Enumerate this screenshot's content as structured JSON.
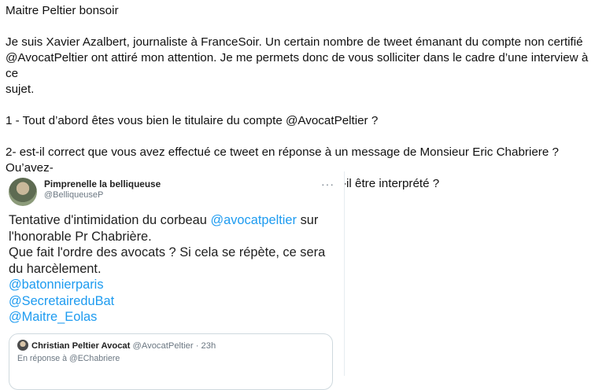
{
  "email": {
    "greeting": "Maitre Peltier bonsoir",
    "intro_line1": "Je suis Xavier Azalbert, journaliste à FranceSoir. Un certain nombre de tweet émanant du compte non certifié",
    "intro_line2": "@AvocatPeltier ont attiré mon attention. Je me permets donc de vous solliciter dans le cadre d’une interview à ce",
    "intro_line3": "sujet.",
    "question1": "1 - Tout d’abord êtes vous bien le titulaire du compte @AvocatPeltier ?",
    "question2_line1": "2- est-il correct que vous avez effectué ce tweet en réponse à un message de Monsieur Eric Chabriere ? Qu’avez-",
    "question2_line2": "vous voulu dire par « on my way » ? Comment ce message doit-il être interprété ?"
  },
  "tweet": {
    "author_name": "Pimprenelle la belliqueuse",
    "author_handle": "@BelliqueuseP",
    "more_icon": "more-dots-icon",
    "text_part1": "Tentative d'intimidation du corbeau ",
    "mention_avocat": "@avocatpeltier",
    "text_part2": " sur",
    "text_line2": "l'honorable Pr Chabrière.",
    "text_line3": "Que fait l'ordre des avocats ? Si cela se répète, ce sera",
    "text_line4": "du harcèlement.",
    "mentions": [
      "@batonnierparis",
      "@SecretaireduBat",
      "@Maitre_Eolas"
    ],
    "quoted": {
      "name": "Christian Peltier Avocat",
      "handle": "@AvocatPeltier",
      "separator": "·",
      "time": "23h",
      "reply_to": "En réponse à @EChabriere"
    }
  }
}
